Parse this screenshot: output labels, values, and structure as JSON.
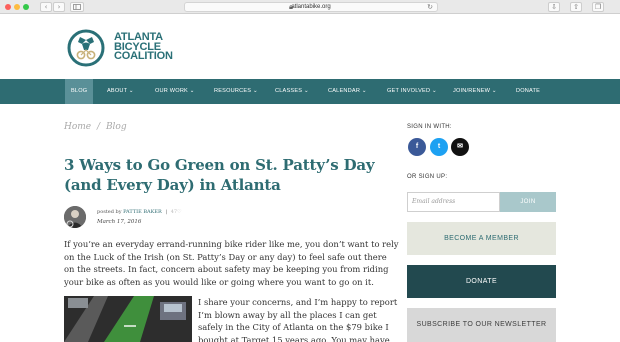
{
  "browser": {
    "url": "atlantabike.org",
    "colors": {
      "close": "#fc605c",
      "minimize": "#fdbc40",
      "zoom": "#34c84a"
    }
  },
  "site": {
    "logo": {
      "line1": "ATLANTA",
      "line2": "BICYCLE",
      "line3": "COALITION"
    },
    "brand_color": "#2e6c72"
  },
  "nav": {
    "items": [
      {
        "label": "BLOG"
      },
      {
        "label": "ABOUT ⌄"
      },
      {
        "label": "OUR WORK ⌄"
      },
      {
        "label": "RESOURCES ⌄"
      },
      {
        "label": "CLASSES ⌄"
      },
      {
        "label": "CALENDAR ⌄"
      },
      {
        "label": "GET INVOLVED ⌄"
      },
      {
        "label": "JOIN/RENEW ⌄"
      },
      {
        "label": "DONATE"
      }
    ],
    "active": "BLOG"
  },
  "article": {
    "breadcrumb": {
      "home": "Home",
      "sep": "/",
      "current": "Blog"
    },
    "title": "3 Ways to Go Green on St. Patty’s Day (and Every Day) in Atlanta",
    "posted_by": "posted by",
    "author": "PATTIE BAKER",
    "sep": "|",
    "views": "47♡",
    "date": "March 17, 2016",
    "para1": "If you’re an everyday errand-running bike rider like me, you don’t want to rely on the Luck of the Irish (on St. Patty’s Day or any day) to feel safe out there on the streets. In fact, concern about safety may be keeping you from riding your bike as often as you would like or going where you want to go on it.",
    "para2": "I share your concerns, and I’m happy to report I’m blown away by all the places I can get safely in the City of Atlanta on the $79 bike I bought at Target 15 years ago. You may have seen me"
  },
  "sidebar": {
    "signin_label": "SIGN IN WITH:",
    "social": [
      {
        "icon": "facebook-icon",
        "glyph": "f"
      },
      {
        "icon": "twitter-icon",
        "glyph": "t"
      },
      {
        "icon": "email-icon",
        "glyph": "✉"
      }
    ],
    "signup_label": "OR SIGN UP:",
    "email_placeholder": "Email address",
    "join_label": "JOIN",
    "member_label": "BECOME A MEMBER",
    "donate_label": "DONATE",
    "newsletter_label": "SUBSCRIBE TO OUR NEWSLETTER"
  }
}
